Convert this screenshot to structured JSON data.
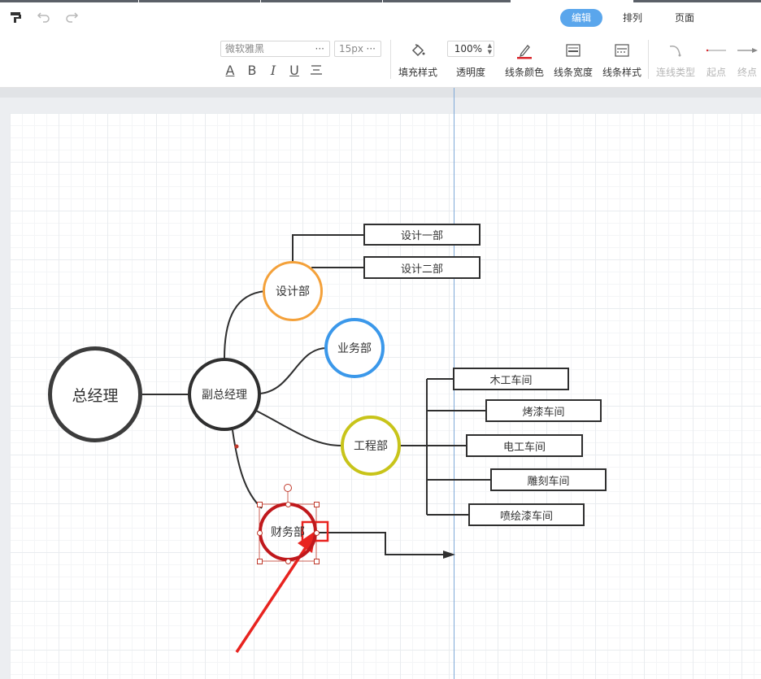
{
  "header": {
    "tabs": [
      "编辑",
      "排列",
      "页面"
    ],
    "active_tab": "编辑"
  },
  "toolbar": {
    "font_family": "微软雅黑",
    "font_size": "15px",
    "opacity": "100%",
    "format_buttons": [
      "A",
      "B",
      "I",
      "U"
    ],
    "tools": {
      "fill_style": "填充样式",
      "opacity": "透明度",
      "line_color": "线条颜色",
      "line_width": "线条宽度",
      "line_style": "线条样式",
      "connector_type": "连线类型",
      "start_point": "起点",
      "end_point": "终点"
    },
    "line_color_hex": "#d9262c"
  },
  "diagram": {
    "nodes": {
      "ceo": {
        "label": "总经理",
        "color": "#3c3c3c"
      },
      "vp": {
        "label": "副总经理",
        "color": "#2f2f2f"
      },
      "design": {
        "label": "设计部",
        "color": "#f4a13a"
      },
      "business": {
        "label": "业务部",
        "color": "#3b98ea"
      },
      "engineering": {
        "label": "工程部",
        "color": "#c8c41a"
      },
      "finance": {
        "label": "财务部",
        "color": "#c0181c"
      }
    },
    "boxes": {
      "design_1": "设计一部",
      "design_2": "设计二部",
      "carpentry": "木工车间",
      "baking_paint": "烤漆车间",
      "electrical": "电工车间",
      "carving": "雕刻车间",
      "spray_paint": "喷绘漆车间"
    },
    "annotation_color": "#e8231f"
  }
}
